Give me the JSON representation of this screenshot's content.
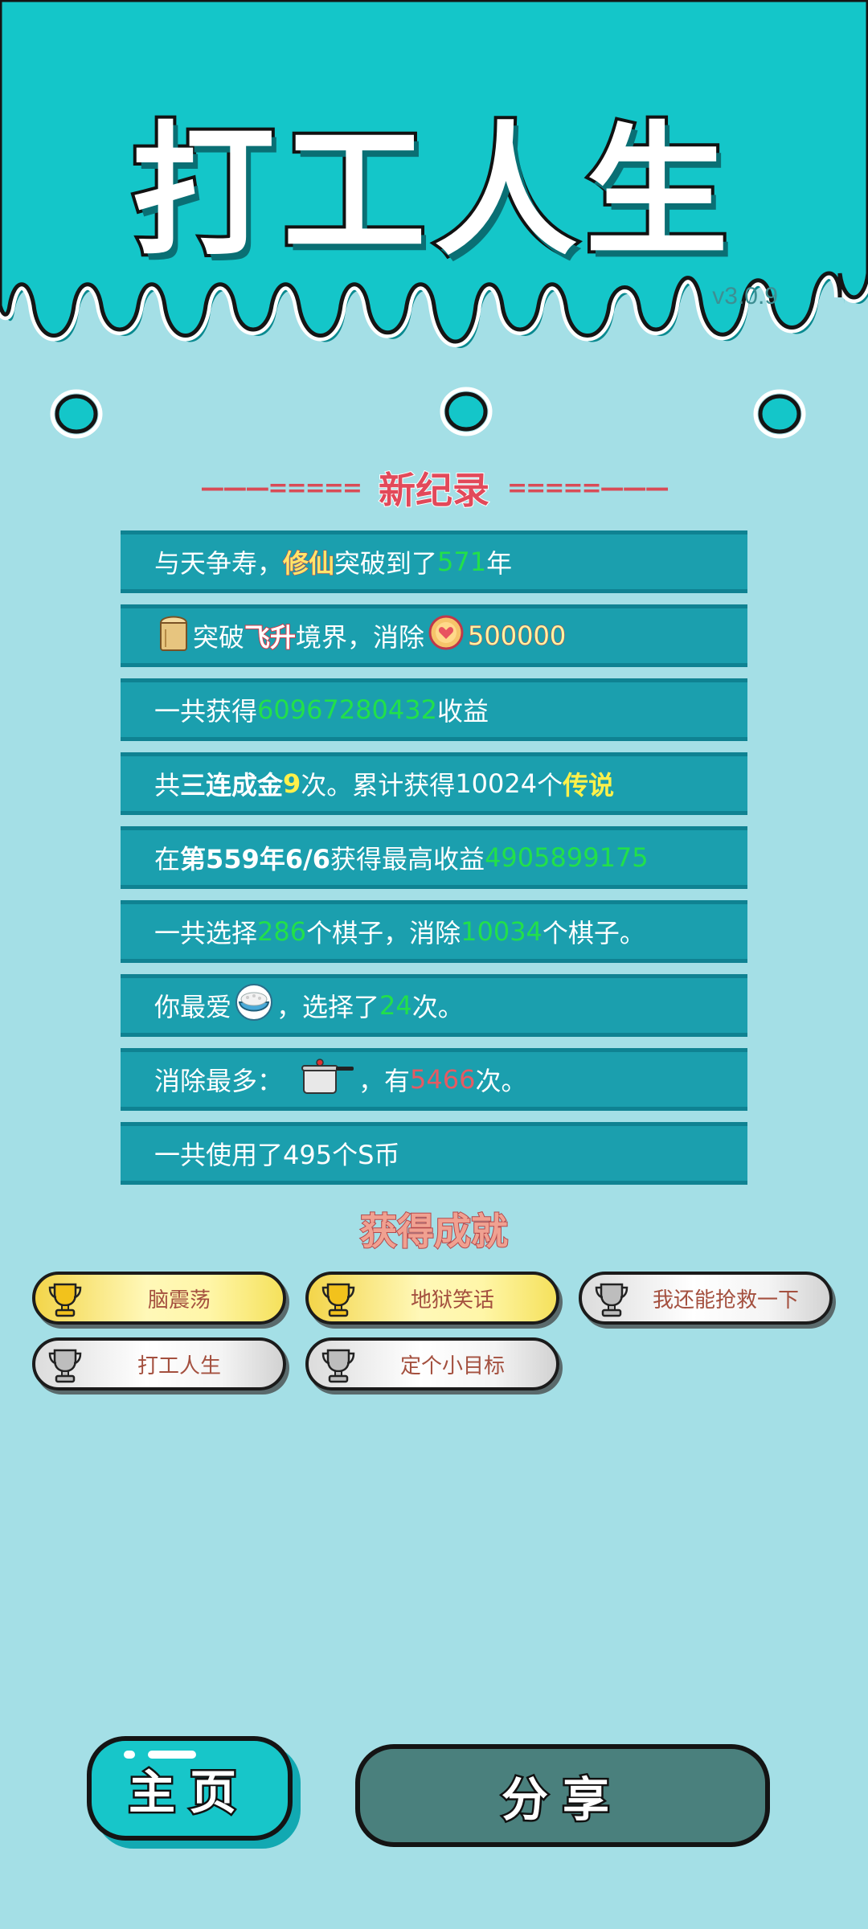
{
  "app": {
    "title": "打工人生",
    "version": "v3.0.9",
    "colors": {
      "top_bg": "#14c6c9",
      "page_bg": "#a4dfe6",
      "row_bg": "#1b9fae",
      "green": "#22e04a",
      "yellow": "#fff14a",
      "red": "#e65a62"
    }
  },
  "record": {
    "heading": "新纪录",
    "dash_left": "———=====",
    "dash_right": "=====———"
  },
  "stats": {
    "row1": {
      "a": "与天争寿，",
      "b": "修仙",
      "c": "突破到了",
      "d": "571",
      "e": "年"
    },
    "row2": {
      "icon": "scroll-icon",
      "a": "突破",
      "b": "飞升",
      "c": "境界，消除",
      "icon2": "heart-coin-icon",
      "d": "500000"
    },
    "row3": {
      "a": "一共获得",
      "b": "60967280432",
      "c": "收益"
    },
    "row4": {
      "a": "共",
      "b": "三连成金",
      "c": "9",
      "d": "次。累计获得",
      "e": "10024",
      "f": "个",
      "g": "传说"
    },
    "row5": {
      "a": "在 ",
      "b": "第559年6/6",
      "c": " 获得最高收益",
      "d": "4905899175"
    },
    "row6": {
      "a": "一共选择",
      "b": "286",
      "c": "个棋子，消除",
      "d": "10034",
      "e": "个棋子。"
    },
    "row7": {
      "a": "你最爱",
      "icon": "rice-bowl-icon",
      "b": "，选择了",
      "c": "24",
      "d": "次。"
    },
    "row8": {
      "a": "消除最多：",
      "icon": "pressure-cooker-icon",
      "b": "，有",
      "c": "5466",
      "d": "次。"
    },
    "row9": {
      "a": "一共使用了495个S币"
    }
  },
  "achievements": {
    "title": "获得成就",
    "items": [
      {
        "label": "脑震荡",
        "tier": "gold",
        "icon": "trophy-icon"
      },
      {
        "label": "地狱笑话",
        "tier": "gold",
        "icon": "trophy-icon"
      },
      {
        "label": "我还能抢救一下",
        "tier": "silver",
        "icon": "trophy-icon"
      },
      {
        "label": "打工人生",
        "tier": "silver",
        "icon": "trophy-icon"
      },
      {
        "label": "定个小目标",
        "tier": "silver",
        "icon": "trophy-icon"
      }
    ]
  },
  "buttons": {
    "home": "主页",
    "share": "分享"
  }
}
